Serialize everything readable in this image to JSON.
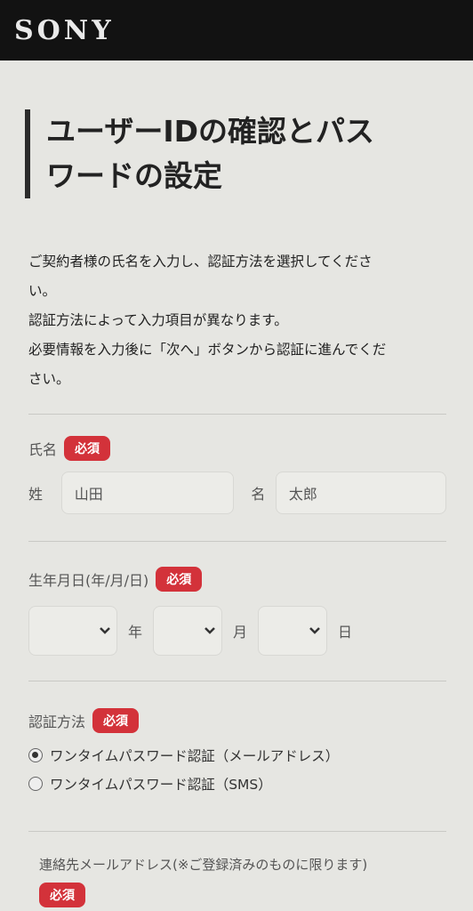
{
  "header": {
    "logo_text": "SONY"
  },
  "page": {
    "title_line1": "ユーザーIDの確認とパス",
    "title_line2": "ワードの設定"
  },
  "intro": {
    "line1": "ご契約者様の氏名を入力し、認証方法を選択してくださ",
    "line2": "い。",
    "line3": "認証方法によって入力項目が異なります。",
    "line4": "必要情報を入力後に「次へ」ボタンから認証に進んでくだ",
    "line5": "さい。"
  },
  "form": {
    "required_badge": "必須",
    "name": {
      "label": "氏名",
      "last_name_label": "姓",
      "last_name_value": "山田",
      "first_name_label": "名",
      "first_name_value": "太郎"
    },
    "birthdate": {
      "label": "生年月日(年/月/日)",
      "year_unit": "年",
      "month_unit": "月",
      "day_unit": "日"
    },
    "auth_method": {
      "label": "認証方法",
      "options": [
        {
          "label": "ワンタイムパスワード認証（メールアドレス）",
          "selected": true
        },
        {
          "label": "ワンタイムパスワード認証（SMS）",
          "selected": false
        }
      ]
    },
    "email": {
      "label": "連絡先メールアドレス(※ご登録済みのものに限ります)"
    }
  },
  "icons": {
    "select_arrow": "chevron-down-icon"
  }
}
